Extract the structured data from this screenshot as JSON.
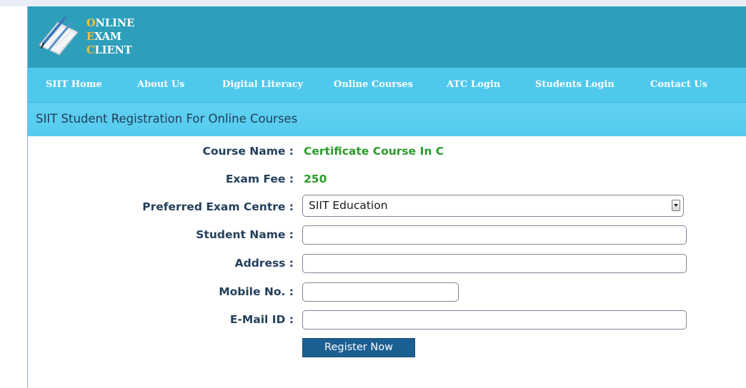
{
  "logo": {
    "lines": [
      {
        "initial": "O",
        "rest": "NLINE"
      },
      {
        "initial": "E",
        "rest": "XAM"
      },
      {
        "initial": "C",
        "rest": "LIENT"
      }
    ]
  },
  "nav": {
    "items": [
      {
        "label": "SIIT Home"
      },
      {
        "label": "About Us"
      },
      {
        "label": "Digital Literacy"
      },
      {
        "label": "Online Courses"
      },
      {
        "label": "ATC Login"
      },
      {
        "label": "Students Login"
      },
      {
        "label": "Contact Us"
      }
    ]
  },
  "page": {
    "title": "SIIT Student Registration For Online Courses"
  },
  "form": {
    "course_name_label": "Course Name :",
    "course_name_value": "Certificate Course In C",
    "exam_fee_label": "Exam Fee :",
    "exam_fee_value": "250",
    "exam_centre_label": "Preferred Exam Centre :",
    "exam_centre_selected": "SIIT Education",
    "student_name_label": "Student Name :",
    "student_name_value": "",
    "address_label": "Address :",
    "address_value": "",
    "mobile_label": "Mobile No. :",
    "mobile_value": "",
    "email_label": "E-Mail ID :",
    "email_value": "",
    "submit_label": "Register Now"
  },
  "colors": {
    "header_bg": "#2e9fba",
    "nav_bg": "#4fc8ee",
    "logo_initial": "#f7c33b",
    "label_text": "#24405c",
    "value_text": "#2a9c2a",
    "button_bg": "#1c5f92"
  }
}
